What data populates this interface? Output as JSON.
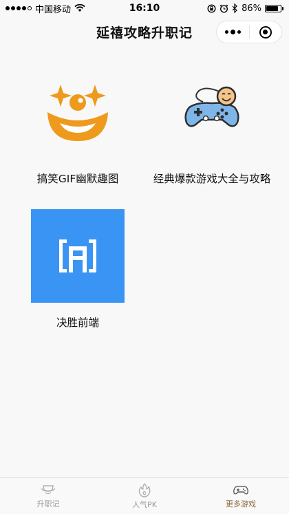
{
  "status_bar": {
    "carrier": "中国移动",
    "time": "16:10",
    "battery": "86%",
    "battery_level": 0.86
  },
  "nav": {
    "title": "延禧攻略升职记"
  },
  "apps": [
    {
      "label": "搞笑GIF幽默趣图",
      "icon": "clown-face-icon"
    },
    {
      "label": "经典爆款游戏大全与攻略",
      "icon": "gamepad-icon"
    },
    {
      "label": "决胜前端",
      "icon": "frontend-logo-icon"
    }
  ],
  "tabs": [
    {
      "label": "升职记",
      "icon": "official-hat-icon",
      "active": false
    },
    {
      "label": "人气PK",
      "icon": "flame-icon",
      "active": false
    },
    {
      "label": "更多游戏",
      "icon": "gamepad-tab-icon",
      "active": true
    }
  ],
  "colors": {
    "clown_orange": "#ee9a1c",
    "frontend_blue": "#3a94f4",
    "tab_active": "#8a6d3b",
    "tab_inactive": "#9a9a9a"
  }
}
